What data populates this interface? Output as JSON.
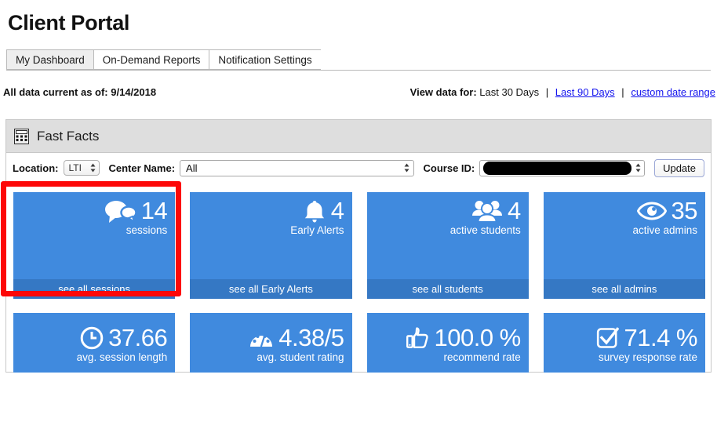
{
  "app": {
    "title": "Client Portal"
  },
  "tabs": [
    {
      "label": "My Dashboard",
      "active": true
    },
    {
      "label": "On-Demand Reports",
      "active": false
    },
    {
      "label": "Notification Settings",
      "active": false
    }
  ],
  "status": {
    "as_of": "All data current as of: 9/14/2018"
  },
  "view_data": {
    "label": "View data for:",
    "current": "Last 30 Days",
    "separator": "|",
    "links": [
      "Last 90 Days",
      "custom date range"
    ]
  },
  "panel": {
    "title": "Fast Facts",
    "icon": "calculator-icon"
  },
  "filters": {
    "location_label": "Location:",
    "location_value": "LTI",
    "center_label": "Center Name:",
    "center_value": "All",
    "course_label": "Course ID:",
    "course_value": "",
    "course_redacted": true,
    "update_label": "Update"
  },
  "tiles": [
    [
      {
        "icon": "chat-bubbles-icon",
        "value": "14",
        "label": "sessions",
        "footer": "see all sessions",
        "highlighted": true
      },
      {
        "icon": "bell-icon",
        "value": "4",
        "label": "Early Alerts",
        "footer": "see all Early Alerts",
        "highlighted": false
      },
      {
        "icon": "people-group-icon",
        "value": "4",
        "label": "active students",
        "footer": "see all students",
        "highlighted": false
      },
      {
        "icon": "eye-icon",
        "value": "35",
        "label": "active admins",
        "footer": "see all admins",
        "highlighted": false
      }
    ],
    [
      {
        "icon": "clock-icon",
        "value": "37.66",
        "label": "avg. session length",
        "footer": "",
        "highlighted": false
      },
      {
        "icon": "gauge-icon",
        "value": "4.38/5",
        "label": "avg. student rating",
        "footer": "",
        "highlighted": false
      },
      {
        "icon": "thumbs-up-icon",
        "value": "100.0 %",
        "label": "recommend rate",
        "footer": "",
        "highlighted": false
      },
      {
        "icon": "checkbox-checked-icon",
        "value": "71.4 %",
        "label": "survey response rate",
        "footer": "",
        "highlighted": false
      }
    ]
  ],
  "colors": {
    "tile_blue": "#408ade",
    "tile_footer_blue": "#3578c4",
    "highlight_red": "#fd0808",
    "link_blue": "#1414ee",
    "panel_header_gray": "#dedede"
  }
}
